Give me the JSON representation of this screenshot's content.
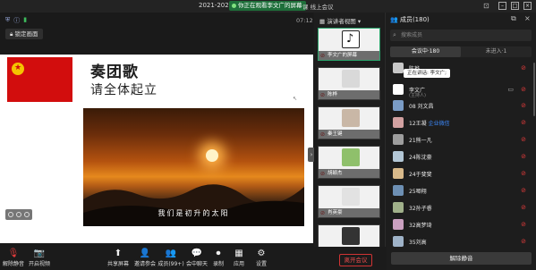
{
  "window": {
    "title": "2021-2022",
    "share_badge": "你正在观看李文广的屏幕",
    "subtitle": "课 线上会议"
  },
  "main": {
    "timer": "07:12",
    "lock_button": "锁定画面",
    "slide": {
      "title": "奏团歌",
      "subtitle": "请全体起立",
      "caption": "我们是初升的太阳"
    }
  },
  "video_strip": {
    "view_label": "演讲者视图",
    "tiles": [
      {
        "name": "李文广的屏幕",
        "color": "#ffffff"
      },
      {
        "name": "陈桦",
        "color": "#d9d9d9"
      },
      {
        "name": "秦王键",
        "color": "#c9b7a6"
      },
      {
        "name": "胡颖杰",
        "color": "#8fc06b"
      },
      {
        "name": "肖英豪",
        "color": "#e2e2e2"
      },
      {
        "name": "",
        "color": "#333333"
      }
    ]
  },
  "members": {
    "title": "成员(180)",
    "search_placeholder": "搜索成员",
    "tabs": [
      "会议中·180",
      "未进入·1"
    ],
    "list": [
      {
        "name": "陈桦",
        "sub": "",
        "color": "#c8c8c8"
      },
      {
        "name": "李文广",
        "sub": "(主持人)",
        "color": "#ffffff"
      },
      {
        "name": "08 刘文昌",
        "sub": "",
        "color": "#7a9cc6"
      },
      {
        "name": "12王凝",
        "tag": "企业微信",
        "sub": "",
        "color": "#d2a1a1"
      },
      {
        "name": "21熊一凡",
        "sub": "",
        "color": "#9d9d9d"
      },
      {
        "name": "24陈沈豪",
        "sub": "",
        "color": "#b3c7d6"
      },
      {
        "name": "24于斐斐",
        "sub": "",
        "color": "#d8b98a"
      },
      {
        "name": "25唧翔",
        "sub": "",
        "color": "#6d8fb3"
      },
      {
        "name": "32孙子睿",
        "sub": "",
        "color": "#a0b08a"
      },
      {
        "name": "32高梦琦",
        "sub": "",
        "color": "#caa0c0"
      },
      {
        "name": "35刘高",
        "sub": "",
        "color": "#9fb3c8"
      }
    ],
    "speaking": "正在讲话: 李文广;",
    "mute_all": "解除静音"
  },
  "toolbar": {
    "items": [
      {
        "label": "解除静音",
        "icon": "mic-off-icon",
        "glyph": "🎙",
        "red": true
      },
      {
        "label": "开启视频",
        "icon": "camera-off-icon",
        "glyph": "📷",
        "red": true
      },
      {
        "label": "共享屏幕",
        "icon": "share-screen-icon",
        "glyph": "⬆",
        "red": false
      },
      {
        "label": "邀请参会",
        "icon": "invite-icon",
        "glyph": "👤",
        "red": false
      },
      {
        "label": "成员(99+)",
        "icon": "members-icon",
        "glyph": "👥",
        "red": false
      },
      {
        "label": "会中聊天",
        "icon": "chat-icon",
        "glyph": "💬",
        "red": false
      },
      {
        "label": "录制",
        "icon": "record-icon",
        "glyph": "⏺",
        "red": false
      },
      {
        "label": "应用",
        "icon": "apps-icon",
        "glyph": "▦",
        "red": false
      },
      {
        "label": "设置",
        "icon": "settings-icon",
        "glyph": "⚙",
        "red": false
      }
    ],
    "leave": "离开会议"
  }
}
